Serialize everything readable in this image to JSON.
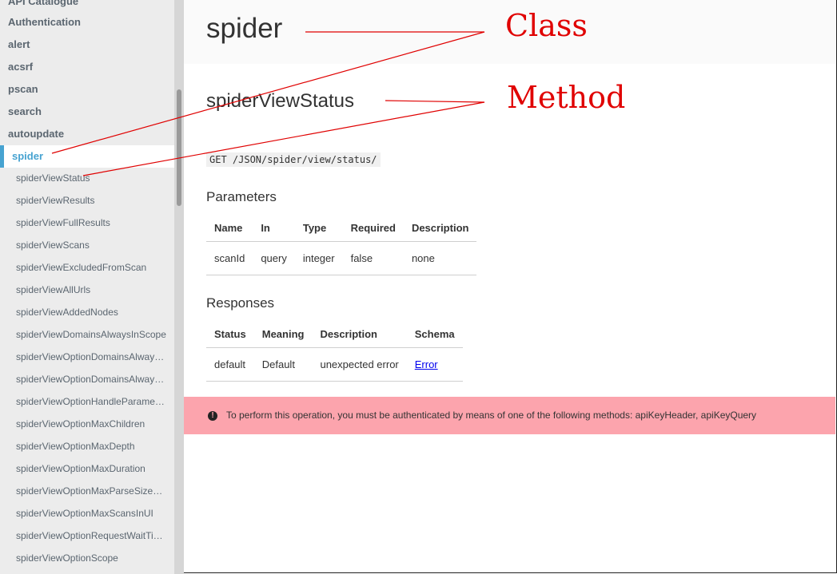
{
  "sidebar": {
    "top_items": [
      "API Catalogue",
      "Authentication",
      "alert",
      "acsrf",
      "pscan",
      "search",
      "autoupdate"
    ],
    "active_item": "spider",
    "sub_items": [
      "spiderViewStatus",
      "spiderViewResults",
      "spiderViewFullResults",
      "spiderViewScans",
      "spiderViewExcludedFromScan",
      "spiderViewAllUrls",
      "spiderViewAddedNodes",
      "spiderViewDomainsAlwaysInScope",
      "spiderViewOptionDomainsAlway…",
      "spiderViewOptionDomainsAlway…",
      "spiderViewOptionHandleParame…",
      "spiderViewOptionMaxChildren",
      "spiderViewOptionMaxDepth",
      "spiderViewOptionMaxDuration",
      "spiderViewOptionMaxParseSize…",
      "spiderViewOptionMaxScansInUI",
      "spiderViewOptionRequestWaitTi…",
      "spiderViewOptionScope"
    ]
  },
  "content": {
    "class_title": "spider",
    "method_title": "spiderViewStatus",
    "endpoint": "GET /JSON/spider/view/status/",
    "parameters_heading": "Parameters",
    "parameters": {
      "headers": [
        "Name",
        "In",
        "Type",
        "Required",
        "Description"
      ],
      "rows": [
        [
          "scanId",
          "query",
          "integer",
          "false",
          "none"
        ]
      ]
    },
    "responses_heading": "Responses",
    "responses": {
      "headers": [
        "Status",
        "Meaning",
        "Description",
        "Schema"
      ],
      "rows": [
        [
          "default",
          "Default",
          "unexpected error",
          "Error"
        ]
      ]
    },
    "auth_notice": "To perform this operation, you must be authenticated by means of one of the following methods: apiKeyHeader, apiKeyQuery",
    "auth_icon": "exclamation-circle-icon"
  },
  "annotations": {
    "class_label": "Class",
    "method_label": "Method",
    "color": "#e00000"
  },
  "colors": {
    "active_accent": "#47a3d1",
    "banner": "#fca4ad"
  }
}
